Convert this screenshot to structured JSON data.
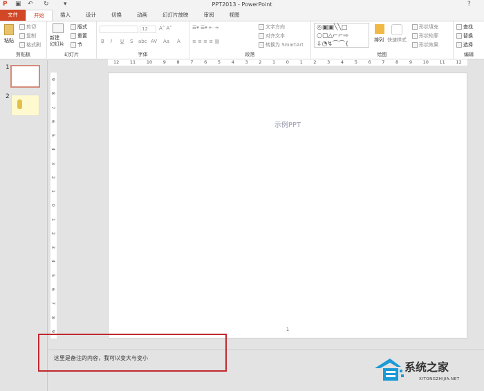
{
  "window": {
    "title": "PPT2013 - PowerPoint",
    "help": "?"
  },
  "quick_access": {
    "app_icon": "P",
    "save": "▣",
    "undo": "↶",
    "redo": "↻",
    "customize": "▾"
  },
  "tabs": [
    "文件",
    "开始",
    "插入",
    "设计",
    "切换",
    "动画",
    "幻灯片放映",
    "审阅",
    "视图"
  ],
  "active_tab": "开始",
  "ribbon": {
    "clipboard": {
      "label": "剪贴板",
      "paste": "粘贴",
      "cut": "剪切",
      "copy": "复制",
      "format_painter": "格式刷"
    },
    "slides": {
      "label": "幻灯片",
      "new_slide": "新建\n幻灯片",
      "layout": "版式",
      "reset": "重置",
      "section": "节"
    },
    "font": {
      "label": "字体",
      "size": "12",
      "bold": "B",
      "italic": "I",
      "underline": "U",
      "strike": "S",
      "abc": "abc",
      "spacing": "AV",
      "case": "Aa",
      "color": "A"
    },
    "paragraph": {
      "label": "段落",
      "text_direction": "文字方向",
      "align_text": "对齐文本",
      "smartart": "转换为 SmartArt"
    },
    "drawing": {
      "label": "绘图",
      "arrange": "排列",
      "quick_styles": "快速样式",
      "shape_fill": "形状填充",
      "shape_outline": "形状轮廓",
      "shape_effects": "形状效果"
    },
    "editing": {
      "label": "编辑",
      "find": "查找",
      "replace": "替换",
      "select": "选择"
    }
  },
  "hruler": [
    "12",
    "11",
    "10",
    "9",
    "8",
    "7",
    "6",
    "5",
    "4",
    "3",
    "2",
    "1",
    "0",
    "1",
    "2",
    "3",
    "4",
    "5",
    "6",
    "7",
    "8",
    "9",
    "10",
    "11",
    "12"
  ],
  "vruler": [
    "9",
    "8",
    "7",
    "6",
    "5",
    "4",
    "3",
    "2",
    "1",
    "0",
    "1",
    "2",
    "3",
    "4",
    "5",
    "6",
    "7",
    "8",
    "9"
  ],
  "thumbnails": [
    {
      "number": "1"
    },
    {
      "number": "2"
    }
  ],
  "slide": {
    "title": "示例PPT",
    "page_number": "1"
  },
  "notes": {
    "text": "这里是备注的内容，我可以变大与变小"
  },
  "watermark": {
    "brand": "系统之家",
    "url": "XITONGZHIJIA.NET"
  },
  "colors": {
    "accent": "#d24726",
    "highlight": "#c0282e",
    "watermark": "#1a9ad6"
  }
}
